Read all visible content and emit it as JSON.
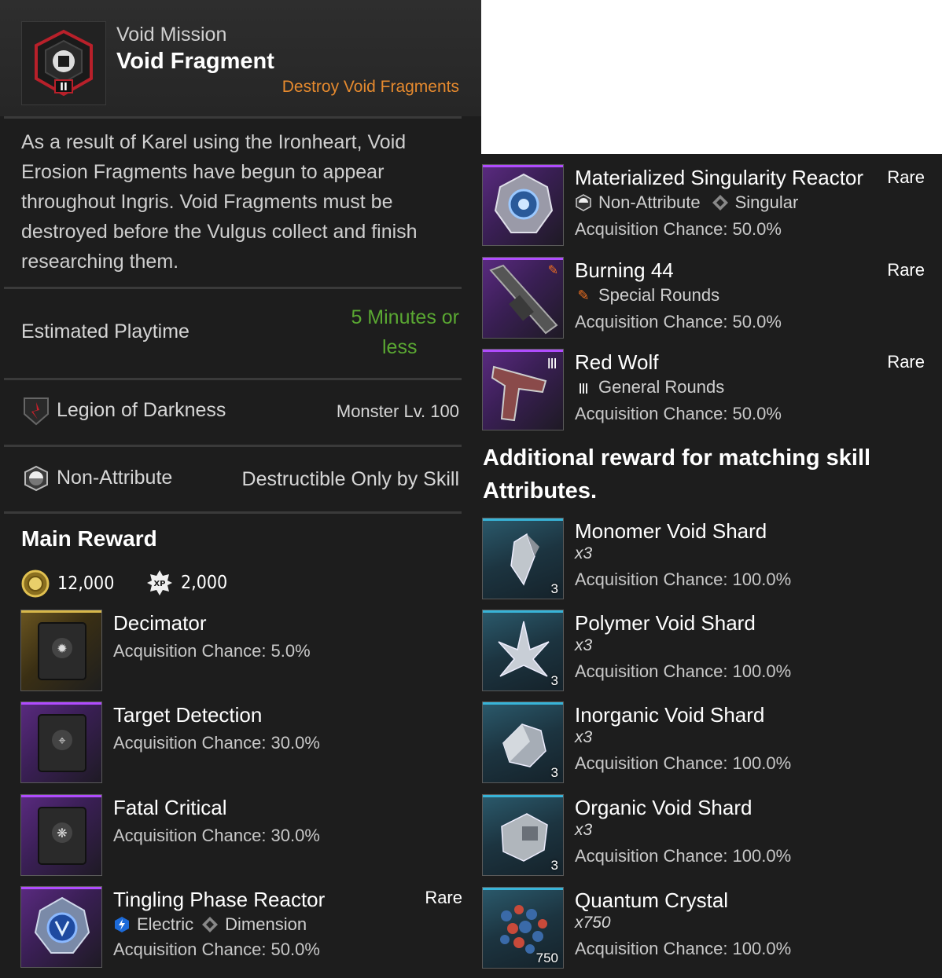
{
  "mission": {
    "category": "Void Mission",
    "title": "Void Fragment",
    "subtitle": "Destroy Void Fragments",
    "description": "As a result of Karel using the Ironheart, Void Erosion Fragments have begun to appear throughout Ingris. Void Fragments must be destroyed before the Vulgus collect and finish researching them.",
    "playtime_label": "Estimated Playtime",
    "playtime_value_line1": "5 Minutes or",
    "playtime_value_line2": "less",
    "faction": "Legion of Darkness",
    "monster_level": "Monster Lv. 100",
    "attribute": "Non-Attribute",
    "destructible": "Destructible Only by Skill",
    "mission_icon_rank": "II"
  },
  "main_reward": {
    "title": "Main Reward",
    "gold": "12,000",
    "xp": "2,000",
    "xp_badge": "XP",
    "items": [
      {
        "name": "Decimator",
        "chance": "Acquisition Chance: 5.0%",
        "frame": "gold"
      },
      {
        "name": "Target Detection",
        "chance": "Acquisition Chance: 30.0%",
        "frame": "purple"
      },
      {
        "name": "Fatal Critical",
        "chance": "Acquisition Chance: 30.0%",
        "frame": "purple"
      },
      {
        "name": "Tingling Phase Reactor",
        "rarity": "Rare",
        "attr1": "Electric",
        "attr2": "Dimension",
        "chance": "Acquisition Chance: 50.0%",
        "frame": "purple"
      }
    ]
  },
  "right_rewards": [
    {
      "name": "Materialized Singularity Reactor",
      "rarity": "Rare",
      "attr1": "Non-Attribute",
      "attr2": "Singular",
      "chance": "Acquisition Chance: 50.0%",
      "frame": "purple"
    },
    {
      "name": "Burning 44",
      "rarity": "Rare",
      "attr1": "Special Rounds",
      "chance": "Acquisition Chance: 50.0%",
      "frame": "purple"
    },
    {
      "name": "Red Wolf",
      "rarity": "Rare",
      "attr1": "General Rounds",
      "chance": "Acquisition Chance: 50.0%",
      "frame": "purple"
    }
  ],
  "additional": {
    "title": "Additional reward for matching skill Attributes.",
    "items": [
      {
        "name": "Monomer Void Shard",
        "qty": "x3",
        "count": "3",
        "chance": "Acquisition Chance: 100.0%"
      },
      {
        "name": "Polymer Void Shard",
        "qty": "x3",
        "count": "3",
        "chance": "Acquisition Chance: 100.0%"
      },
      {
        "name": "Inorganic Void Shard",
        "qty": "x3",
        "count": "3",
        "chance": "Acquisition Chance: 100.0%"
      },
      {
        "name": "Organic Void Shard",
        "qty": "x3",
        "count": "3",
        "chance": "Acquisition Chance: 100.0%"
      },
      {
        "name": "Quantum Crystal",
        "qty": "x750",
        "count": "750",
        "chance": "Acquisition Chance: 100.0%"
      }
    ]
  },
  "colors": {
    "accent_orange": "#e68a2e",
    "playtime_green": "#5aa832",
    "rare_purple": "#b04cff",
    "teal": "#38b4d8",
    "gold": "#d8b84a"
  }
}
